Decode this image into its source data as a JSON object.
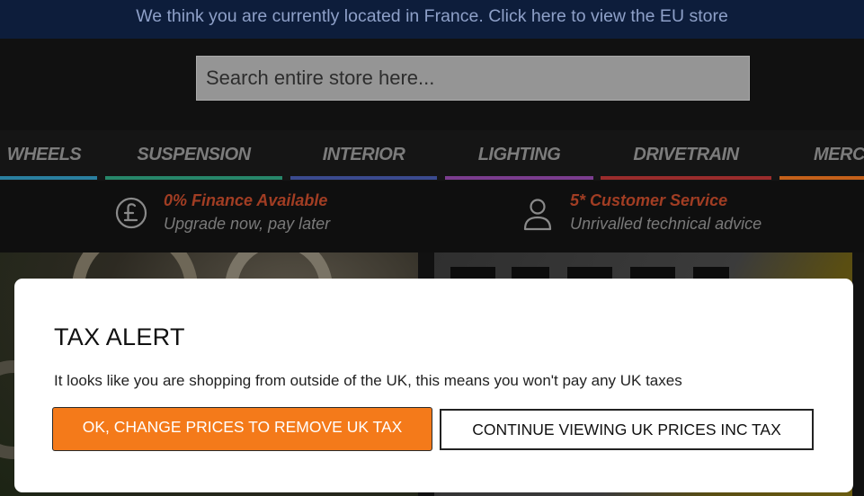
{
  "geo_banner": {
    "text": "We think you are currently located in France. Click here to view the EU store"
  },
  "search": {
    "placeholder": "Search entire store here..."
  },
  "nav": {
    "items": [
      {
        "label": "WHEELS",
        "color": "#2a7fa0"
      },
      {
        "label": "SUSPENSION",
        "color": "#27876a"
      },
      {
        "label": "INTERIOR",
        "color": "#3b4a8f"
      },
      {
        "label": "LIGHTING",
        "color": "#7b3d8f"
      },
      {
        "label": "DRIVETRAIN",
        "color": "#9b2c2c"
      },
      {
        "label": "MERCH",
        "color": "#c4601a"
      }
    ]
  },
  "usps": [
    {
      "icon": "pound-icon",
      "title": "0% Finance Available",
      "subtitle": "Upgrade now, pay later"
    },
    {
      "icon": "user-icon",
      "title": "5* Customer Service",
      "subtitle": "Unrivalled technical advice"
    }
  ],
  "tax_modal": {
    "title": "TAX ALERT",
    "message": "It looks like you are shopping from outside of the UK, this means you won't pay any UK taxes",
    "primary_button": "OK, CHANGE PRICES TO REMOVE UK TAX",
    "secondary_button": "CONTINUE VIEWING UK PRICES INC TAX"
  },
  "colors": {
    "banner_bg": "#0d1d3b",
    "accent_orange": "#f47a1a",
    "usp_title": "#a13d23"
  }
}
